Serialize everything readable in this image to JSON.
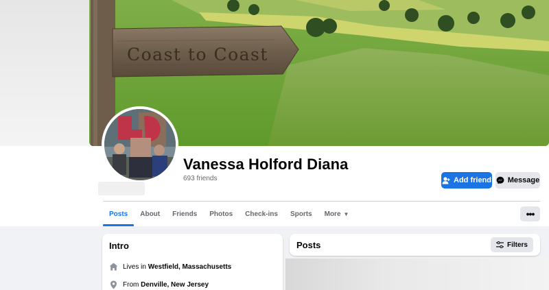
{
  "cover": {
    "sign_text": "Coast to Coast"
  },
  "profile": {
    "name": "Vanessa Holford Diana",
    "friends": "693 friends"
  },
  "actions": {
    "add_friend": "Add friend",
    "message": "Message",
    "more_icon": "ellipsis-icon"
  },
  "tabs": [
    {
      "label": "Posts",
      "active": true
    },
    {
      "label": "About"
    },
    {
      "label": "Friends"
    },
    {
      "label": "Photos"
    },
    {
      "label": "Check-ins"
    },
    {
      "label": "Sports"
    },
    {
      "label": "More"
    }
  ],
  "intro": {
    "title": "Intro",
    "lives_prefix": "Lives in ",
    "lives_place": "Westfield, Massachusetts",
    "from_prefix": "From ",
    "from_place": "Denville, New Jersey"
  },
  "posts": {
    "title": "Posts",
    "filters": "Filters"
  },
  "colors": {
    "accent": "#1b74e4",
    "secondary_button": "#e4e6eb",
    "page_bg": "#f0f2f5",
    "muted_text": "#65676b"
  }
}
